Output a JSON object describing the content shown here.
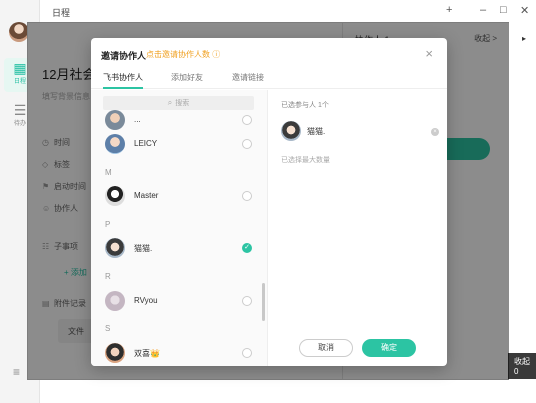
{
  "app": {
    "window_title": "日程",
    "rail": {
      "active_label": "日程",
      "second_label": "待办"
    },
    "task": {
      "title": "12月社会化",
      "description": "填写背景信息",
      "rows": [
        "时间",
        "标签",
        "启动时间",
        "协作人"
      ],
      "subtasks_label": "子事项",
      "add_label": "+ 添加",
      "file_section_label": "附件记录",
      "file_label": "文件"
    },
    "right_pane": {
      "title": "协作人 1",
      "collapse_label": "收起 >"
    },
    "edge_text": "收起 0"
  },
  "modal": {
    "title": "邀请协作人",
    "hint": "点击邀请协作人数 ⓘ",
    "tabs": [
      {
        "label": "飞书协作人",
        "active": true
      },
      {
        "label": "添加好友",
        "active": false
      },
      {
        "label": "邀请链接",
        "active": false
      }
    ],
    "search_placeholder": "搜索",
    "contacts": [
      {
        "name": "...",
        "letter": "",
        "checked": false
      },
      {
        "name": "LEICY",
        "letter": "",
        "checked": false
      },
      {
        "name": "Master",
        "letter": "M",
        "checked": false
      },
      {
        "name": "猫猫.",
        "letter": "P",
        "checked": true
      },
      {
        "name": "RVyou",
        "letter": "R",
        "checked": false
      },
      {
        "name": "双喜👑",
        "letter": "S",
        "checked": false
      }
    ],
    "selected": {
      "count_label": "已选参与人 1个",
      "name": "猫猫.",
      "limit_label": "已选择最大数量"
    },
    "cancel_label": "取消",
    "ok_label": "确定",
    "accent_color": "#2cc4a3",
    "hint_color": "#f0a020"
  }
}
